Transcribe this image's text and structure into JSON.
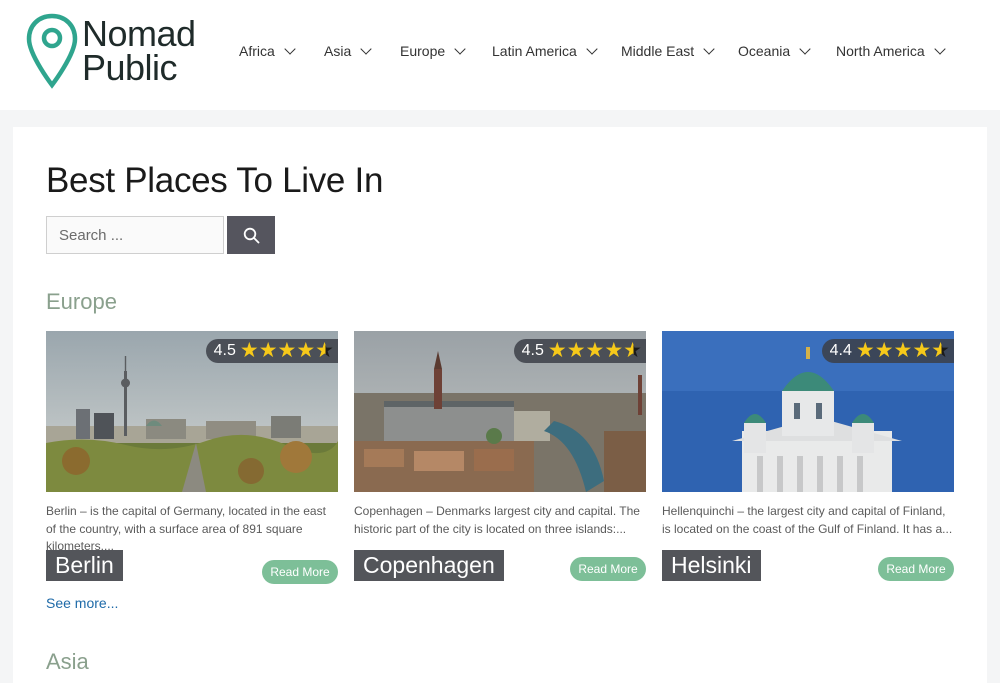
{
  "brand": {
    "name_line1": "Nomad",
    "name_line2": "Public",
    "accent_color": "#2fa58e"
  },
  "nav": {
    "items": [
      {
        "label": "Africa"
      },
      {
        "label": "Asia"
      },
      {
        "label": "Europe"
      },
      {
        "label": "Latin America"
      },
      {
        "label": "Middle East"
      },
      {
        "label": "Oceania"
      },
      {
        "label": "North America"
      }
    ]
  },
  "page": {
    "title": "Best Places To Live In"
  },
  "search": {
    "placeholder": "Search ...",
    "button_icon": "search-icon"
  },
  "sections": [
    {
      "title": "Europe",
      "see_more": "See more...",
      "cards": [
        {
          "city": "Berlin",
          "rating": "4.5",
          "rating_value": 4.5,
          "description": "Berlin – is the capital of Germany, located in the east of the country, with a surface area of 891 square kilometers....",
          "read_more": "Read More"
        },
        {
          "city": "Copenhagen",
          "rating": "4.5",
          "rating_value": 4.5,
          "description": "Copenhagen – Denmarks largest city and capital. The historic part of the city is located on three islands:...",
          "read_more": "Read More"
        },
        {
          "city": "Helsinki",
          "rating": "4.4",
          "rating_value": 4.4,
          "description": "Hellenquinchi – the largest city and capital of Finland, is located on the coast of the Gulf of Finland. It has a...",
          "read_more": "Read More"
        }
      ]
    },
    {
      "title": "Asia"
    }
  ],
  "colors": {
    "section_title": "#8aa08d",
    "read_more_bg": "#7dbf98",
    "link": "#1e6aa8",
    "search_button": "#55555e",
    "star": "#f6c91a"
  }
}
